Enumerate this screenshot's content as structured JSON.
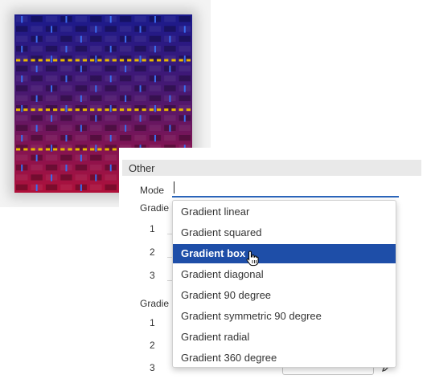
{
  "preview": {
    "icon": "texture-preview",
    "colors": {
      "dark": "#1a1a8c",
      "red": "#b0103a",
      "blue": "#3a6cf0",
      "gold": "#e8b800"
    }
  },
  "section": {
    "title": "Other"
  },
  "mode": {
    "label": "Mode",
    "value": ""
  },
  "groups": [
    {
      "label": "Gradie",
      "rows": [
        "1",
        "2",
        "3"
      ]
    },
    {
      "label": "Gradie",
      "rows": [
        "1",
        "2",
        "3"
      ]
    }
  ],
  "dropdown": {
    "options": [
      "Gradient linear",
      "Gradient squared",
      "Gradient box",
      "Gradient diagonal",
      "Gradient 90 degree",
      "Gradient symmetric 90 degree",
      "Gradient radial",
      "Gradient 360 degree"
    ],
    "selected": "Gradient box",
    "selected_color": "#1e4ea8"
  }
}
